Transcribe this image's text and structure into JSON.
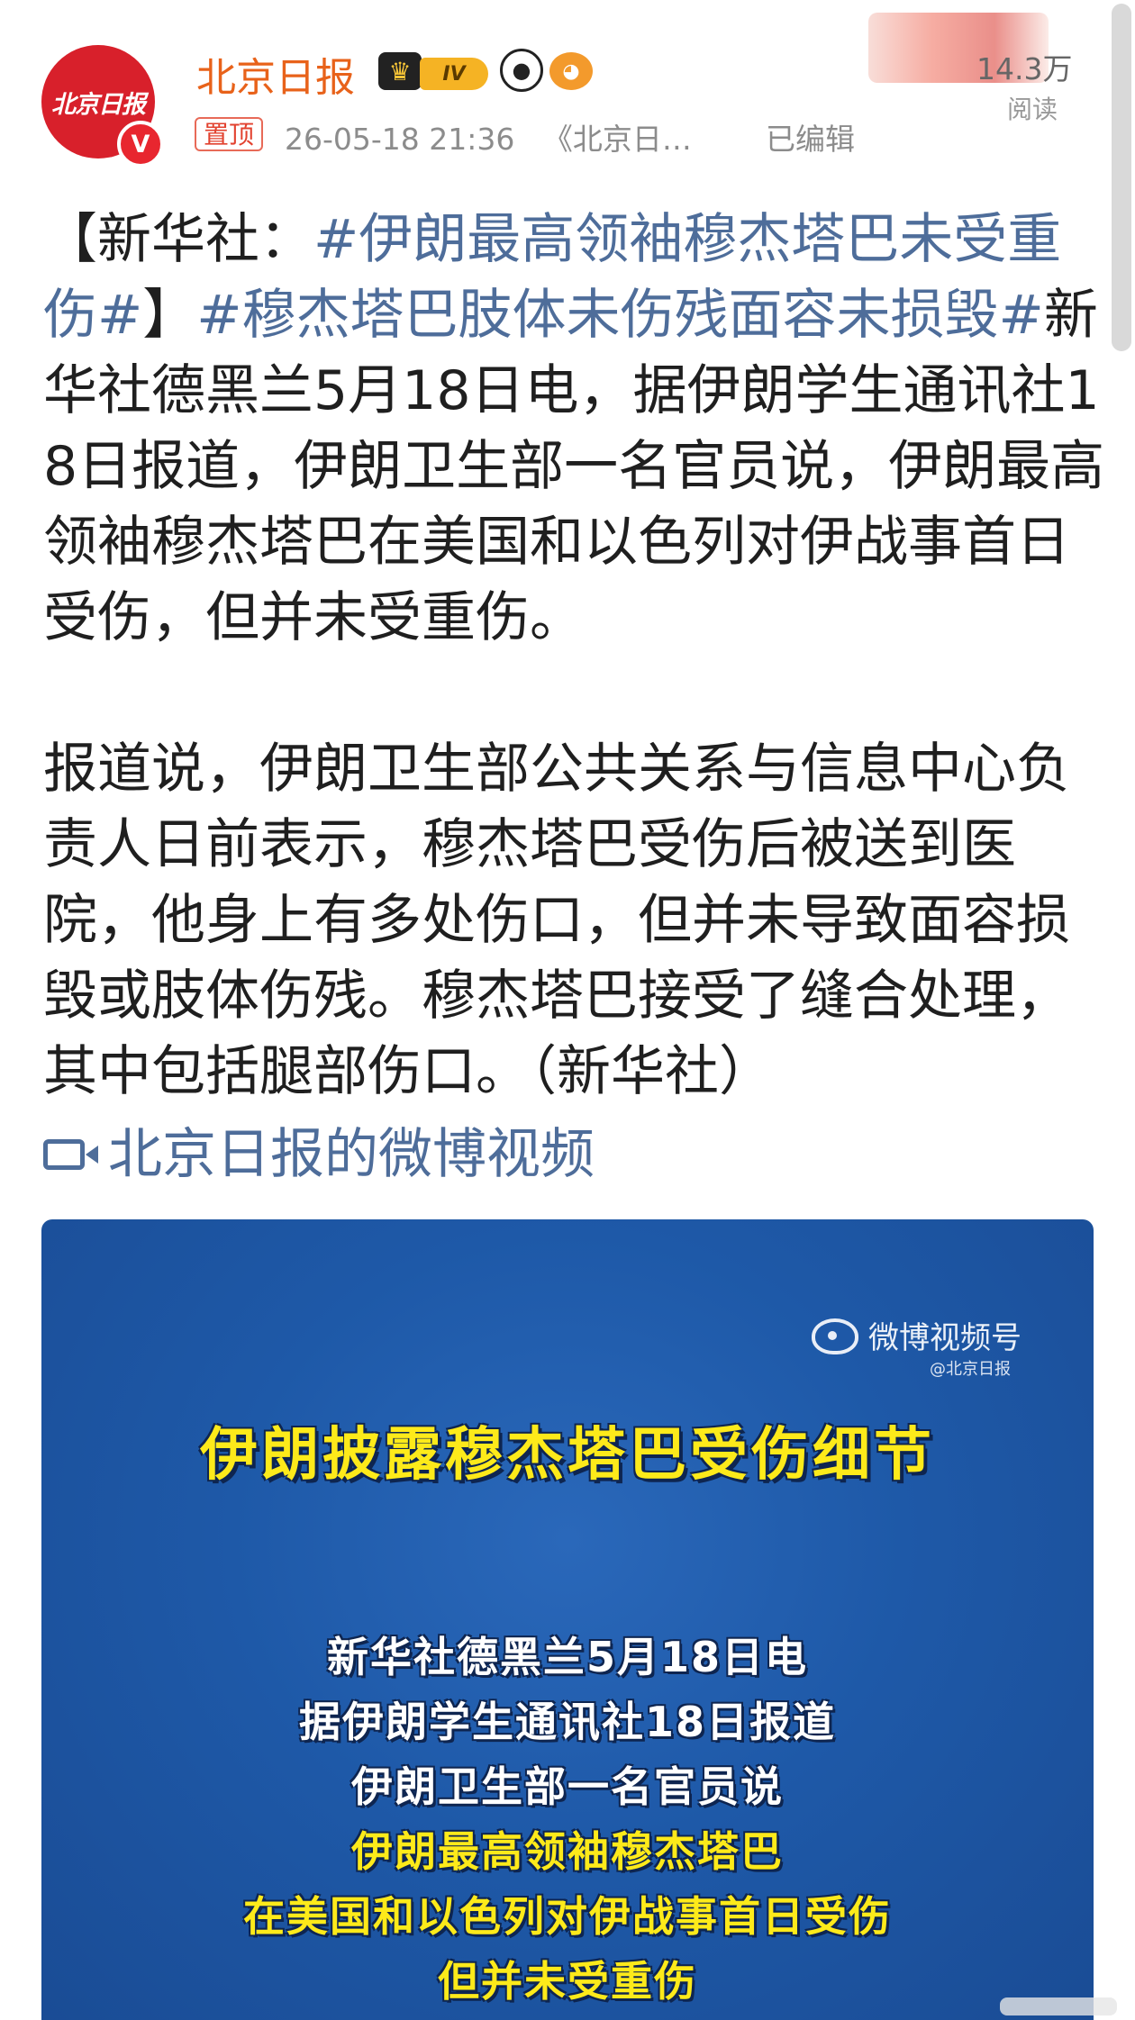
{
  "header": {
    "avatar_text": "北京日报",
    "verified_mark": "V",
    "account_name": "北京日报",
    "level_badge": "IV",
    "pin_label": "置顶",
    "timestamp": "26-05-18 21:36",
    "source": "《北京日…",
    "edited_label": "已编辑",
    "views": "14.3万",
    "views_label": "阅读"
  },
  "post": {
    "para1": [
      {
        "text": "【新华社：",
        "hashtag": false
      },
      {
        "text": "#伊朗最高领袖穆杰塔巴未受重伤#",
        "hashtag": true
      },
      {
        "text": "】",
        "hashtag": false
      },
      {
        "text": "#穆杰塔巴肢体未伤残面容未损毁#",
        "hashtag": true
      },
      {
        "text": "新华社德黑兰5月18日电，据伊朗学生通讯社18日报道，伊朗卫生部一名官员说，伊朗最高领袖穆杰塔巴在美国和以色列对伊战事首日受伤，但并未受重伤。",
        "hashtag": false
      }
    ],
    "para2": "报道说，伊朗卫生部公共关系与信息中心负责人日前表示，穆杰塔巴受伤后被送到医院，他身上有多处伤口，但并未导致面容损毁或肢体伤残。穆杰塔巴接受了缝合处理，其中包括腿部伤口。（新华社）",
    "video_link": "北京日报的微博视频"
  },
  "video": {
    "channel": "微博视频号",
    "handle": "@北京日报",
    "headline": "伊朗披露穆杰塔巴受伤细节",
    "lines": [
      {
        "text": "新华社德黑兰5月18日电",
        "color": "white"
      },
      {
        "text": "据伊朗学生通讯社18日报道",
        "color": "white"
      },
      {
        "text": "伊朗卫生部一名官员说",
        "color": "white"
      },
      {
        "text": "伊朗最高领袖穆杰塔巴",
        "color": "yellow"
      },
      {
        "text": "在美国和以色列对伊战事首日受伤",
        "color": "yellow"
      },
      {
        "text": "但并未受重伤",
        "color": "yellow"
      }
    ]
  },
  "colors": {
    "hashtag": "#4e6d9a",
    "account_name": "#e8621a",
    "brand_red": "#d8202b",
    "video_bg": "#1e59a8",
    "video_highlight": "#fdea1a"
  },
  "icons": [
    "verified-icon",
    "crown-icon",
    "panda-icon",
    "fish-icon",
    "video-camera-icon",
    "weibo-logo-icon"
  ]
}
